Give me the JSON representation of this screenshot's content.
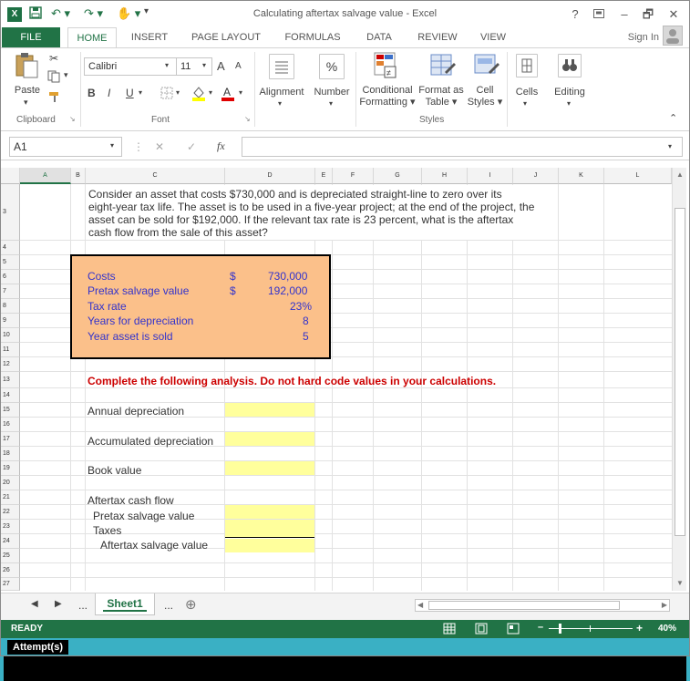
{
  "window": {
    "title": "Calculating aftertax salvage value - Excel",
    "help": "?",
    "minimize": "–",
    "restore": "🗗",
    "close": "✕"
  },
  "tabs": [
    "FILE",
    "HOME",
    "INSERT",
    "PAGE LAYOUT",
    "FORMULAS",
    "DATA",
    "REVIEW",
    "VIEW"
  ],
  "active_tab": "HOME",
  "sign_in": "Sign In",
  "ribbon": {
    "clipboard": {
      "paste": "Paste",
      "group": "Clipboard"
    },
    "font": {
      "name": "Calibri",
      "size": "11",
      "bold": "B",
      "italic": "I",
      "underline": "U",
      "grow": "A",
      "shrink": "A",
      "group": "Font"
    },
    "alignment": {
      "label": "Alignment"
    },
    "number": {
      "label": "Number",
      "icon_text": "%"
    },
    "styles": {
      "conditional": "Conditional Formatting ▾",
      "format_table": "Format as Table ▾",
      "cell_styles": "Cell Styles ▾",
      "group": "Styles"
    },
    "cells": {
      "label": "Cells"
    },
    "editing": {
      "label": "Editing"
    }
  },
  "formula_bar": {
    "name_box": "A1",
    "fx": "fx",
    "cancel": "✕",
    "enter": "✓",
    "value": ""
  },
  "columns": [
    "A",
    "B",
    "C",
    "D",
    "E",
    "F",
    "G",
    "H",
    "I",
    "J",
    "K",
    "L"
  ],
  "rows": [
    "3",
    "4",
    "5",
    "6",
    "7",
    "8",
    "9",
    "10",
    "11",
    "12",
    "13",
    "14",
    "15",
    "16",
    "17",
    "18",
    "19",
    "20",
    "21",
    "22",
    "23",
    "24",
    "25",
    "26",
    "27"
  ],
  "sheet": {
    "problem_line1": "Consider an asset that costs $730,000 and is depreciated straight-line to zero over its",
    "problem_line2": "eight-year tax life. The asset is to be used in a five-year project; at the end of the project, the",
    "problem_line3": "asset can be sold for $192,000. If the relevant tax rate is 23 percent, what is the aftertax",
    "problem_line4": "cash flow from the sale of this asset?",
    "inputs": [
      {
        "label": "Costs",
        "currency": "$",
        "value": "730,000"
      },
      {
        "label": "Pretax salvage value",
        "currency": "$",
        "value": "192,000"
      },
      {
        "label": "Tax rate",
        "currency": "",
        "value": "23%"
      },
      {
        "label": "Years for depreciation",
        "currency": "",
        "value": "8"
      },
      {
        "label": "Year asset is sold",
        "currency": "",
        "value": "5"
      }
    ],
    "instruction": "Complete the following analysis. Do not hard code values in your calculations.",
    "annual_depreciation": "Annual depreciation",
    "accumulated_depreciation": "Accumulated depreciation",
    "book_value": "Book value",
    "aftertax_cash_flow": "Aftertax cash flow",
    "pretax_salvage": "Pretax salvage value",
    "taxes": "Taxes",
    "aftertax_salvage": "Aftertax salvage value"
  },
  "sheet_tabs": {
    "name": "Sheet1",
    "more_left": "...",
    "more_right": "...",
    "add": "⊕"
  },
  "status": {
    "ready": "READY",
    "zoom": "40%"
  },
  "attempts_label": "Attempt(s)",
  "colors": {
    "excel_green": "#217346",
    "input_box": "#fbc08a",
    "answer_cell": "#ffff9c",
    "instruction_red": "#cc0000",
    "input_blue": "#3333cc",
    "attempt_bar": "#3ab0c4"
  }
}
